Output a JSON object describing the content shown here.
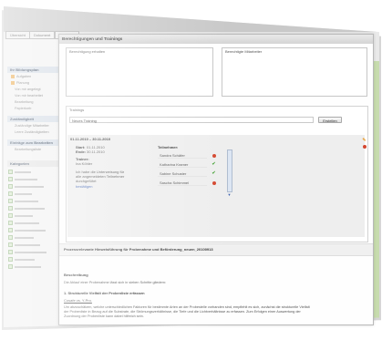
{
  "app": {
    "top_tabs": [
      "Übersicht",
      "Dokument",
      "Schulung"
    ],
    "sidebar": {
      "sections": [
        "Ihr Bildungsplan",
        "Zuständigkeit",
        "Einträge zum Bearbeiten",
        "Kategorien"
      ],
      "items_section1": [
        "Aufgaben",
        "Planung",
        "Von mir angelegt",
        "Von mir bearbeitet",
        "Bearbeitung",
        "Papierkorb"
      ],
      "items_section2": [
        "Zuständige Mitarbeiter",
        "Leere Zuständigkeiten"
      ],
      "items_section3": [
        "Bearbeitungsliste"
      ],
      "category_rows": 14
    }
  },
  "dialog": {
    "title": "Berechtigungen und Trainings",
    "permissions": {
      "left_label": "Berechtigung erhalten",
      "right_label": "Berechtigte Mitarbeiter"
    },
    "training": {
      "section_label": "Trainings",
      "select_value": "Neues Training",
      "add_button": "Erstellen",
      "date_range": "01.11.2010 – 30.11.2010",
      "start_label": "Start:",
      "start_value": "01.11.2010",
      "end_label": "Ende:",
      "end_value": "30.11.2010",
      "trainer_label": "Trainer:",
      "trainer_value": "Ina Köhler",
      "note": "Ich habe die Unterweisung für alle angemeldeten Teilnehmer durchgeführt",
      "note_link": "bestätigen",
      "participants_label": "Teilnehmer:",
      "participants": [
        {
          "name": "Sandra Schäfer",
          "status": "x"
        },
        {
          "name": "Katharina Kramer",
          "status": "check"
        },
        {
          "name": "Sabine Schuster",
          "status": "check"
        },
        {
          "name": "Sascha Schimmel",
          "status": "x"
        }
      ]
    },
    "procedure": {
      "title": "Prozessrelevante Hinweisführung für Probenahme und Beförderung_neuen_20100913",
      "heading": "Beschreibung",
      "intro": "Die Ablauf einer Probenahme lässt sich in sieben Schritte gliedern:",
      "step_title": "1. Strukturelle Vielfalt der Probenliste erfassen",
      "step_sub": "Cosafe vs. Y-Pro.",
      "body": "Um abzuschätzen, welche unterschiedlichen Faktoren für bestimmte Arten an der Probestelle vorhanden sind, empfiehlt es sich, zunächst die strukturelle Vielfalt der Probenliste in Bezug auf die Substrate, die Strömungsverhältnisse, die Tiefe und die Lichtverhältnisse zu erfassen. Zum Erfolgen einer Auswertung der Zuordnung der Probenliste kann dabei hilfreich sein."
    }
  }
}
